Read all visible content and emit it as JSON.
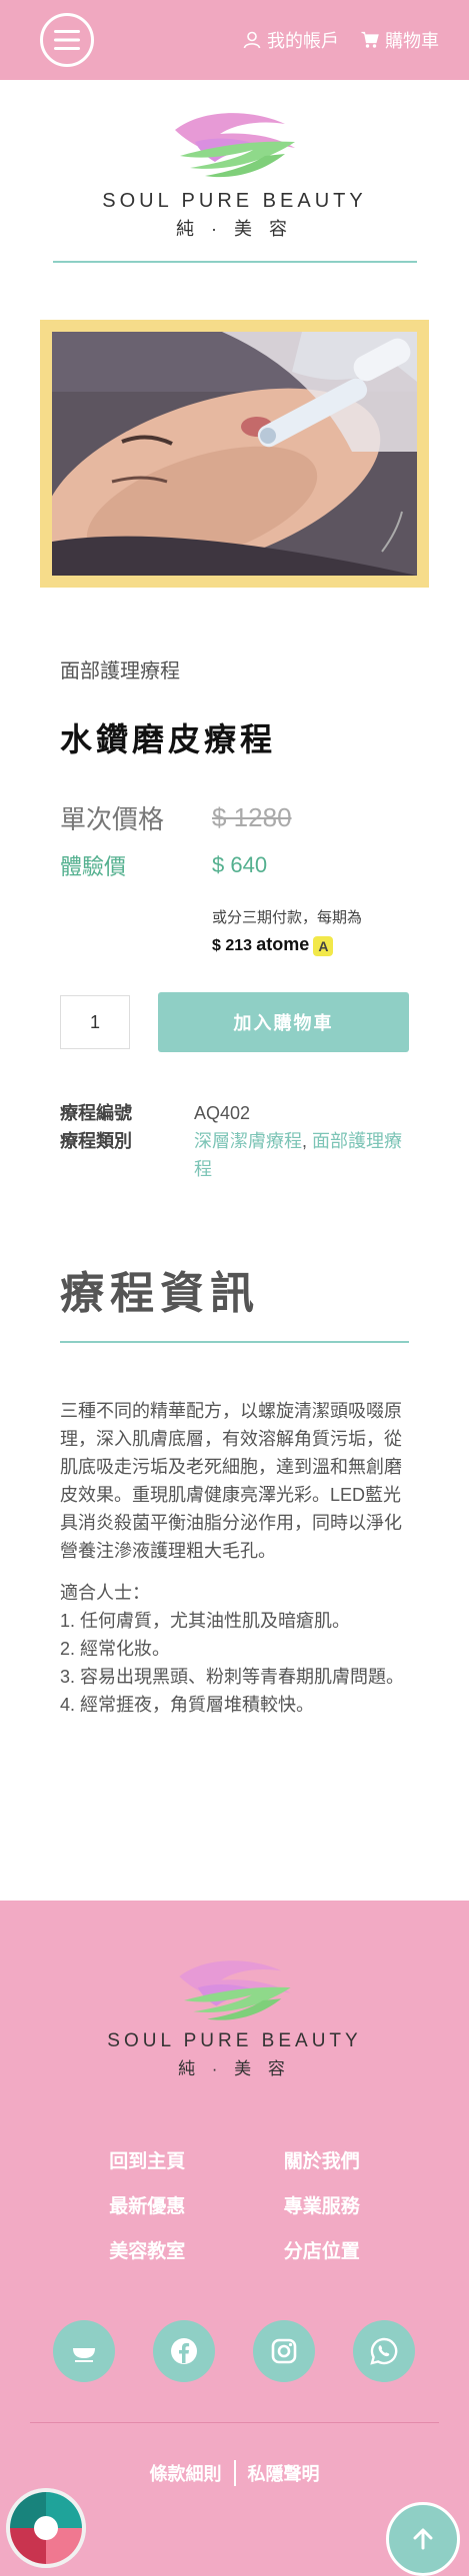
{
  "header": {
    "account_label": "我的帳戶",
    "cart_label": "購物車"
  },
  "brand": {
    "name_en": "SOUL PURE BEAUTY",
    "name_zh": "純 · 美 容"
  },
  "product": {
    "category": "面部護理療程",
    "title": "水鑽磨皮療程",
    "single_price_label": "單次價格",
    "single_price": "$ 1280",
    "trial_label": "體驗價",
    "trial_price": "$ 640",
    "installment_text": "或分三期付款，每期為",
    "installment_amount": "$ 213",
    "installment_provider": "atome",
    "quantity": "1",
    "add_to_cart_label": "加入購物車",
    "code_label": "療程編號",
    "code_value": "AQ402",
    "type_label": "療程類別",
    "type_link_1": "深層潔膚療程",
    "type_sep": ",",
    "type_link_2": "面部護理療程"
  },
  "info": {
    "title": "療程資訊",
    "paragraph": "三種不同的精華配方，以螺旋清潔頭吸啜原理，深入肌膚底層，有效溶解角質污垢，從肌底吸走污垢及老死細胞，達到溫和無創磨皮效果。重現肌膚健康亮澤光彩。LED藍光具消炎殺菌平衡油脂分泌作用，同時以淨化營養注滲液護理粗大毛孔。",
    "suitable_title": "適合人士：",
    "suitable_1": "1. 任何膚質，尤其油性肌及暗瘡肌。",
    "suitable_2": "2. 經常化妝。",
    "suitable_3": "3. 容易出現黑頭、粉刺等青春期肌膚問題。",
    "suitable_4": "4. 經常捱夜，角質層堆積較快。"
  },
  "footer": {
    "links": [
      "回到主頁",
      "關於我們",
      "最新優惠",
      "專業服務",
      "美容教室",
      "分店位置"
    ],
    "social_openrice": "OpenRice",
    "terms_label": "條款細則",
    "privacy_label": "私隱聲明"
  },
  "colors": {
    "pink": "#f0a8c0",
    "teal": "#8fcfc5",
    "green_price": "#54b08f",
    "gold_frame": "#f6dc8a"
  }
}
